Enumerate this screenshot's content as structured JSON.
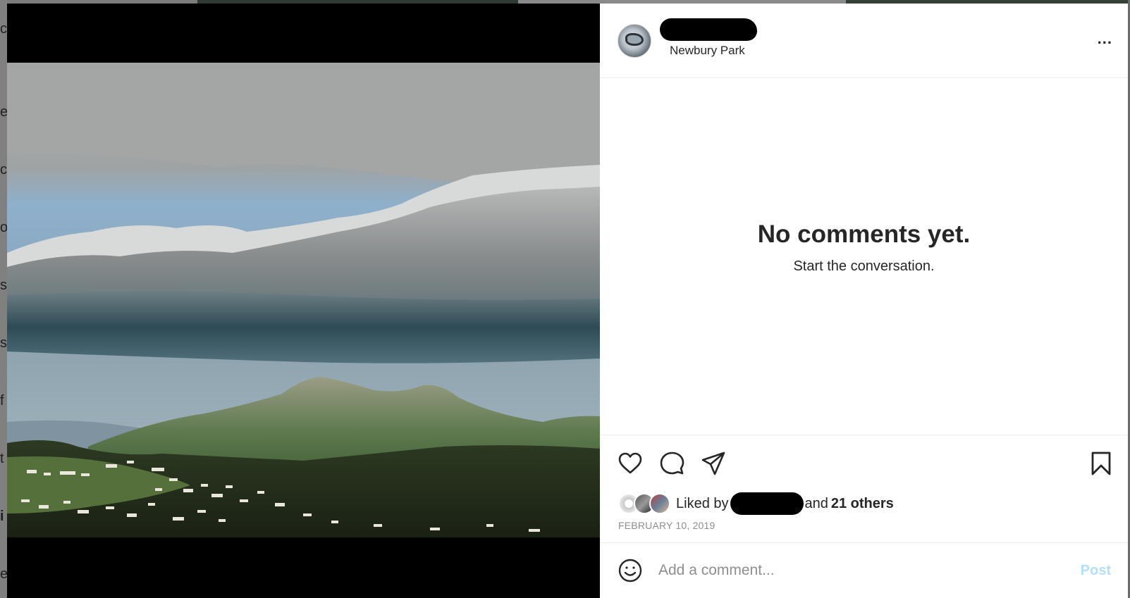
{
  "post": {
    "location": "Newbury Park",
    "more_label": "...",
    "comments": {
      "empty_title": "No comments yet.",
      "empty_subtitle": "Start the conversation."
    },
    "likes": {
      "liked_by_prefix": "Liked by",
      "and_text": "and",
      "others_text": "21 others"
    },
    "date": "FEBRUARY 10, 2019",
    "comment_box": {
      "placeholder": "Add a comment...",
      "post_label": "Post"
    }
  },
  "icons": {
    "like": "heart-icon",
    "comment": "comment-icon",
    "share": "share-icon",
    "save": "bookmark-icon",
    "emoji": "emoji-icon"
  },
  "colors": {
    "post_button_disabled": "#b2dffc",
    "date_gray": "#8e8e8e",
    "text_dark": "#262626"
  }
}
